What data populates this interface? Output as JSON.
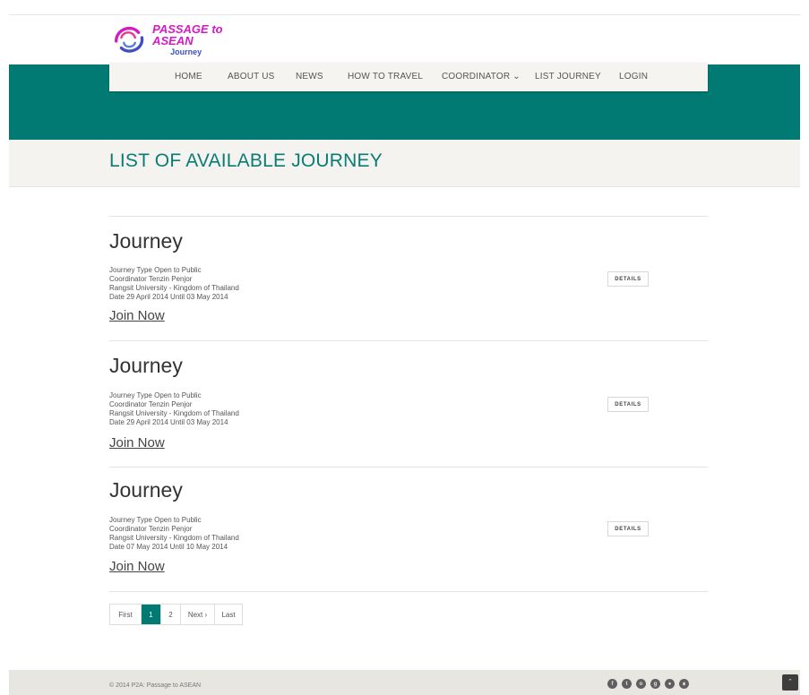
{
  "brand": {
    "title": "PASSAGE to ASEAN",
    "subtitle": "Journey",
    "colors": {
      "teal": "#007a73",
      "magenta": "#d11bc4",
      "blue": "#3f4fbf"
    }
  },
  "nav": {
    "items": [
      {
        "label": "HOME"
      },
      {
        "label": "ABOUT US"
      },
      {
        "label": "NEWS"
      },
      {
        "label": "HOW TO TRAVEL"
      },
      {
        "label": "COORDINATOR ⌄"
      },
      {
        "label": "LIST JOURNEY"
      },
      {
        "label": "LOGIN"
      }
    ]
  },
  "page": {
    "title": "LIST OF AVAILABLE JOURNEY"
  },
  "journeys": [
    {
      "title": "Journey",
      "type": "Journey Type Open to Public",
      "coordinator": "Coordinator Tenzin Penjor",
      "location": "Rangsit University - Kingdom of Thailand",
      "date": "Date 29 April 2014 Until 03 May 2014",
      "join_label": "Join Now",
      "details_label": "DETAILS"
    },
    {
      "title": "Journey",
      "type": "Journey Type Open to Public",
      "coordinator": "Coordinator Tenzin Penjor",
      "location": "Rangsit University - Kingdom of Thailand",
      "date": "Date 29 April 2014 Until 03 May 2014",
      "join_label": "Join Now",
      "details_label": "DETAILS"
    },
    {
      "title": "Journey",
      "type": "Journey Type Open to Public",
      "coordinator": "Coordinator Tenzin Penjor",
      "location": "Rangsit University - Kingdom of Thailand",
      "date": "Date 07 May 2014 Until 10 May 2014",
      "join_label": "Join Now",
      "details_label": "DETAILS"
    }
  ],
  "pagination": {
    "first": "First",
    "pages": [
      "1",
      "2"
    ],
    "current": "1",
    "next": "Next ›",
    "last": "Last"
  },
  "footer": {
    "copyright": "© 2014 P2A: Passage to ASEAN",
    "social": [
      "facebook-icon",
      "twitter-icon",
      "circle-icon",
      "google-plus-icon",
      "user-icon",
      "rss-icon"
    ],
    "to_top": "»"
  }
}
